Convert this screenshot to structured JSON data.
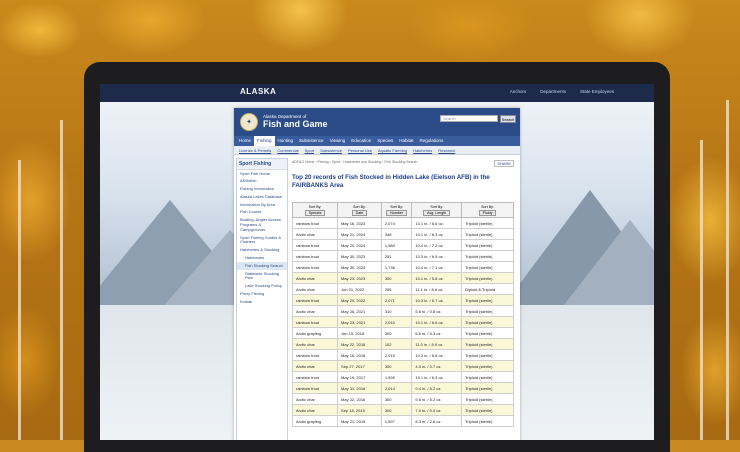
{
  "header": {
    "site_logo": "ALASKA",
    "top_links": [
      "Anchors",
      "Departments",
      "State Employees"
    ]
  },
  "banner": {
    "dept_small": "Alaska Department of",
    "dept_big": "Fish and Game",
    "search_placeholder": "Search",
    "search_button": "Search"
  },
  "main_nav": [
    "Home",
    "Fishing",
    "Hunting",
    "Subsistence",
    "Viewing",
    "Education",
    "Species",
    "Habitat",
    "Regulations"
  ],
  "sub_nav": [
    "License & Permits",
    "Commercial",
    "Sport",
    "Subsistence",
    "Personal Use",
    "Aquatic Farming",
    "Hatcheries",
    "Research"
  ],
  "sidebar": {
    "heading": "Sport Fishing",
    "items": [
      {
        "label": "Sport Fish Home",
        "sub": false,
        "sel": false
      },
      {
        "label": "AKBofish",
        "sub": false,
        "sel": false
      },
      {
        "label": "Fishing Information",
        "sub": false,
        "sel": false
      },
      {
        "label": "Alaska Lakes Database",
        "sub": false,
        "sel": false
      },
      {
        "label": "Information By Area",
        "sub": false,
        "sel": false
      },
      {
        "label": "Fish Counts",
        "sub": false,
        "sel": false
      },
      {
        "label": "Boating, Angler Access Programs & Campgrounds",
        "sub": false,
        "sel": false
      },
      {
        "label": "Sport Fishing Guides & Charters",
        "sub": false,
        "sel": false
      },
      {
        "label": "Hatcheries & Stocking",
        "sub": false,
        "sel": false
      },
      {
        "label": "Hatcheries",
        "sub": true,
        "sel": false
      },
      {
        "label": "Fish Stocking Search",
        "sub": true,
        "sel": true
      },
      {
        "label": "Statewide Stocking Plan",
        "sub": true,
        "sel": false
      },
      {
        "label": "Lake Stocking Policy",
        "sub": true,
        "sel": false
      },
      {
        "label": "Proxy Fishing",
        "sub": false,
        "sel": false
      },
      {
        "label": "Kodiak",
        "sub": false,
        "sel": false
      }
    ]
  },
  "content": {
    "breadcrumb": "ADF&G Home › Fishing › Sport › Hatcheries and Stocking › Fish Stocking Search",
    "share_label": "SHARE",
    "title_prefix": "Top 20 records of Fish Stocked in ",
    "title_lake": "Hidden Lake (Eielson AFB)",
    "title_mid": " in the ",
    "title_area": "FAIRBANKS",
    "title_suffix": " Area",
    "sort_by": "Sort By:",
    "columns": [
      "Species",
      "Date",
      "Number",
      "Avg. Length",
      "Ploidy"
    ],
    "rows": [
      [
        "rainbow trout",
        "May 16, 2023",
        "2,074",
        "10.1 in. / 6.6 oz.",
        "Triploid (sterile)"
      ],
      [
        "Arctic char",
        "May 21, 2024",
        "348",
        "10.1 in. / 6.3 oz.",
        "Triploid (sterile)"
      ],
      [
        "rainbow trout",
        "May 20, 2024",
        "1,980",
        "10.4 in. / 7.2 oz.",
        "Triploid (sterile)"
      ],
      [
        "rainbow trout",
        "May 30, 2023",
        "251",
        "10.3 in. / 6.9 oz.",
        "Triploid (sterile)"
      ],
      [
        "rainbow trout",
        "May 30, 2023",
        "1,736",
        "10.4 in. / 7.1 oz.",
        "Triploid (sterile)"
      ],
      [
        "Arctic char",
        "May 23, 2023",
        "300",
        "10.1 in. / 5.8 oz.",
        "Triploid (sterile)"
      ],
      [
        "Arctic char",
        "Jun 01, 2022",
        "255",
        "11.1 in. / 8.6 oz.",
        "Diploid & Triploid"
      ],
      [
        "rainbow trout",
        "May 20, 2022",
        "2,071",
        "10.3 in. / 6.7 oz.",
        "Triploid (sterile)"
      ],
      [
        "Arctic char",
        "May 25, 2021",
        "310",
        "5.6 in. / 0.8 oz.",
        "Triploid (sterile)"
      ],
      [
        "rainbow trout",
        "May 23, 2021",
        "2,010",
        "10.1 in. / 6.6 oz.",
        "Triploid (sterile)"
      ],
      [
        "Arctic grayling",
        "Jun 15, 2018",
        "300",
        "6.6 in. / 5.3 oz.",
        "Triploid (sterile)"
      ],
      [
        "Arctic char",
        "May 22, 2018",
        "102",
        "11.0 in. / 8.9 oz.",
        "Triploid (sterile)"
      ],
      [
        "rainbow trout",
        "May 16, 2018",
        "2,015",
        "10.3 in. / 6.8 oz.",
        "Triploid (sterile)"
      ],
      [
        "Arctic char",
        "Sep 27, 2017",
        "300",
        "4.0 in. / 0.7 oz.",
        "Triploid (sterile)"
      ],
      [
        "rainbow trout",
        "May 19, 2017",
        "1,999",
        "10.1 in. / 6.3 oz.",
        "Triploid (sterile)"
      ],
      [
        "rainbow trout",
        "May 31, 2016",
        "2,014",
        "9.4 in. / 5.2 oz.",
        "Triploid (sterile)"
      ],
      [
        "Arctic char",
        "May 22, 2016",
        "300",
        "9.6 in. / 5.2 oz.",
        "Triploid (sterile)"
      ],
      [
        "Arctic char",
        "Sep 18, 2015",
        "300",
        "7.0 in. / 0.0 oz.",
        "Triploid (sterile)"
      ],
      [
        "Arctic grayling",
        "May 21, 2015",
        "1,597",
        "8.3 in. / 2.6 oz.",
        "Triploid (sterile)"
      ]
    ]
  }
}
